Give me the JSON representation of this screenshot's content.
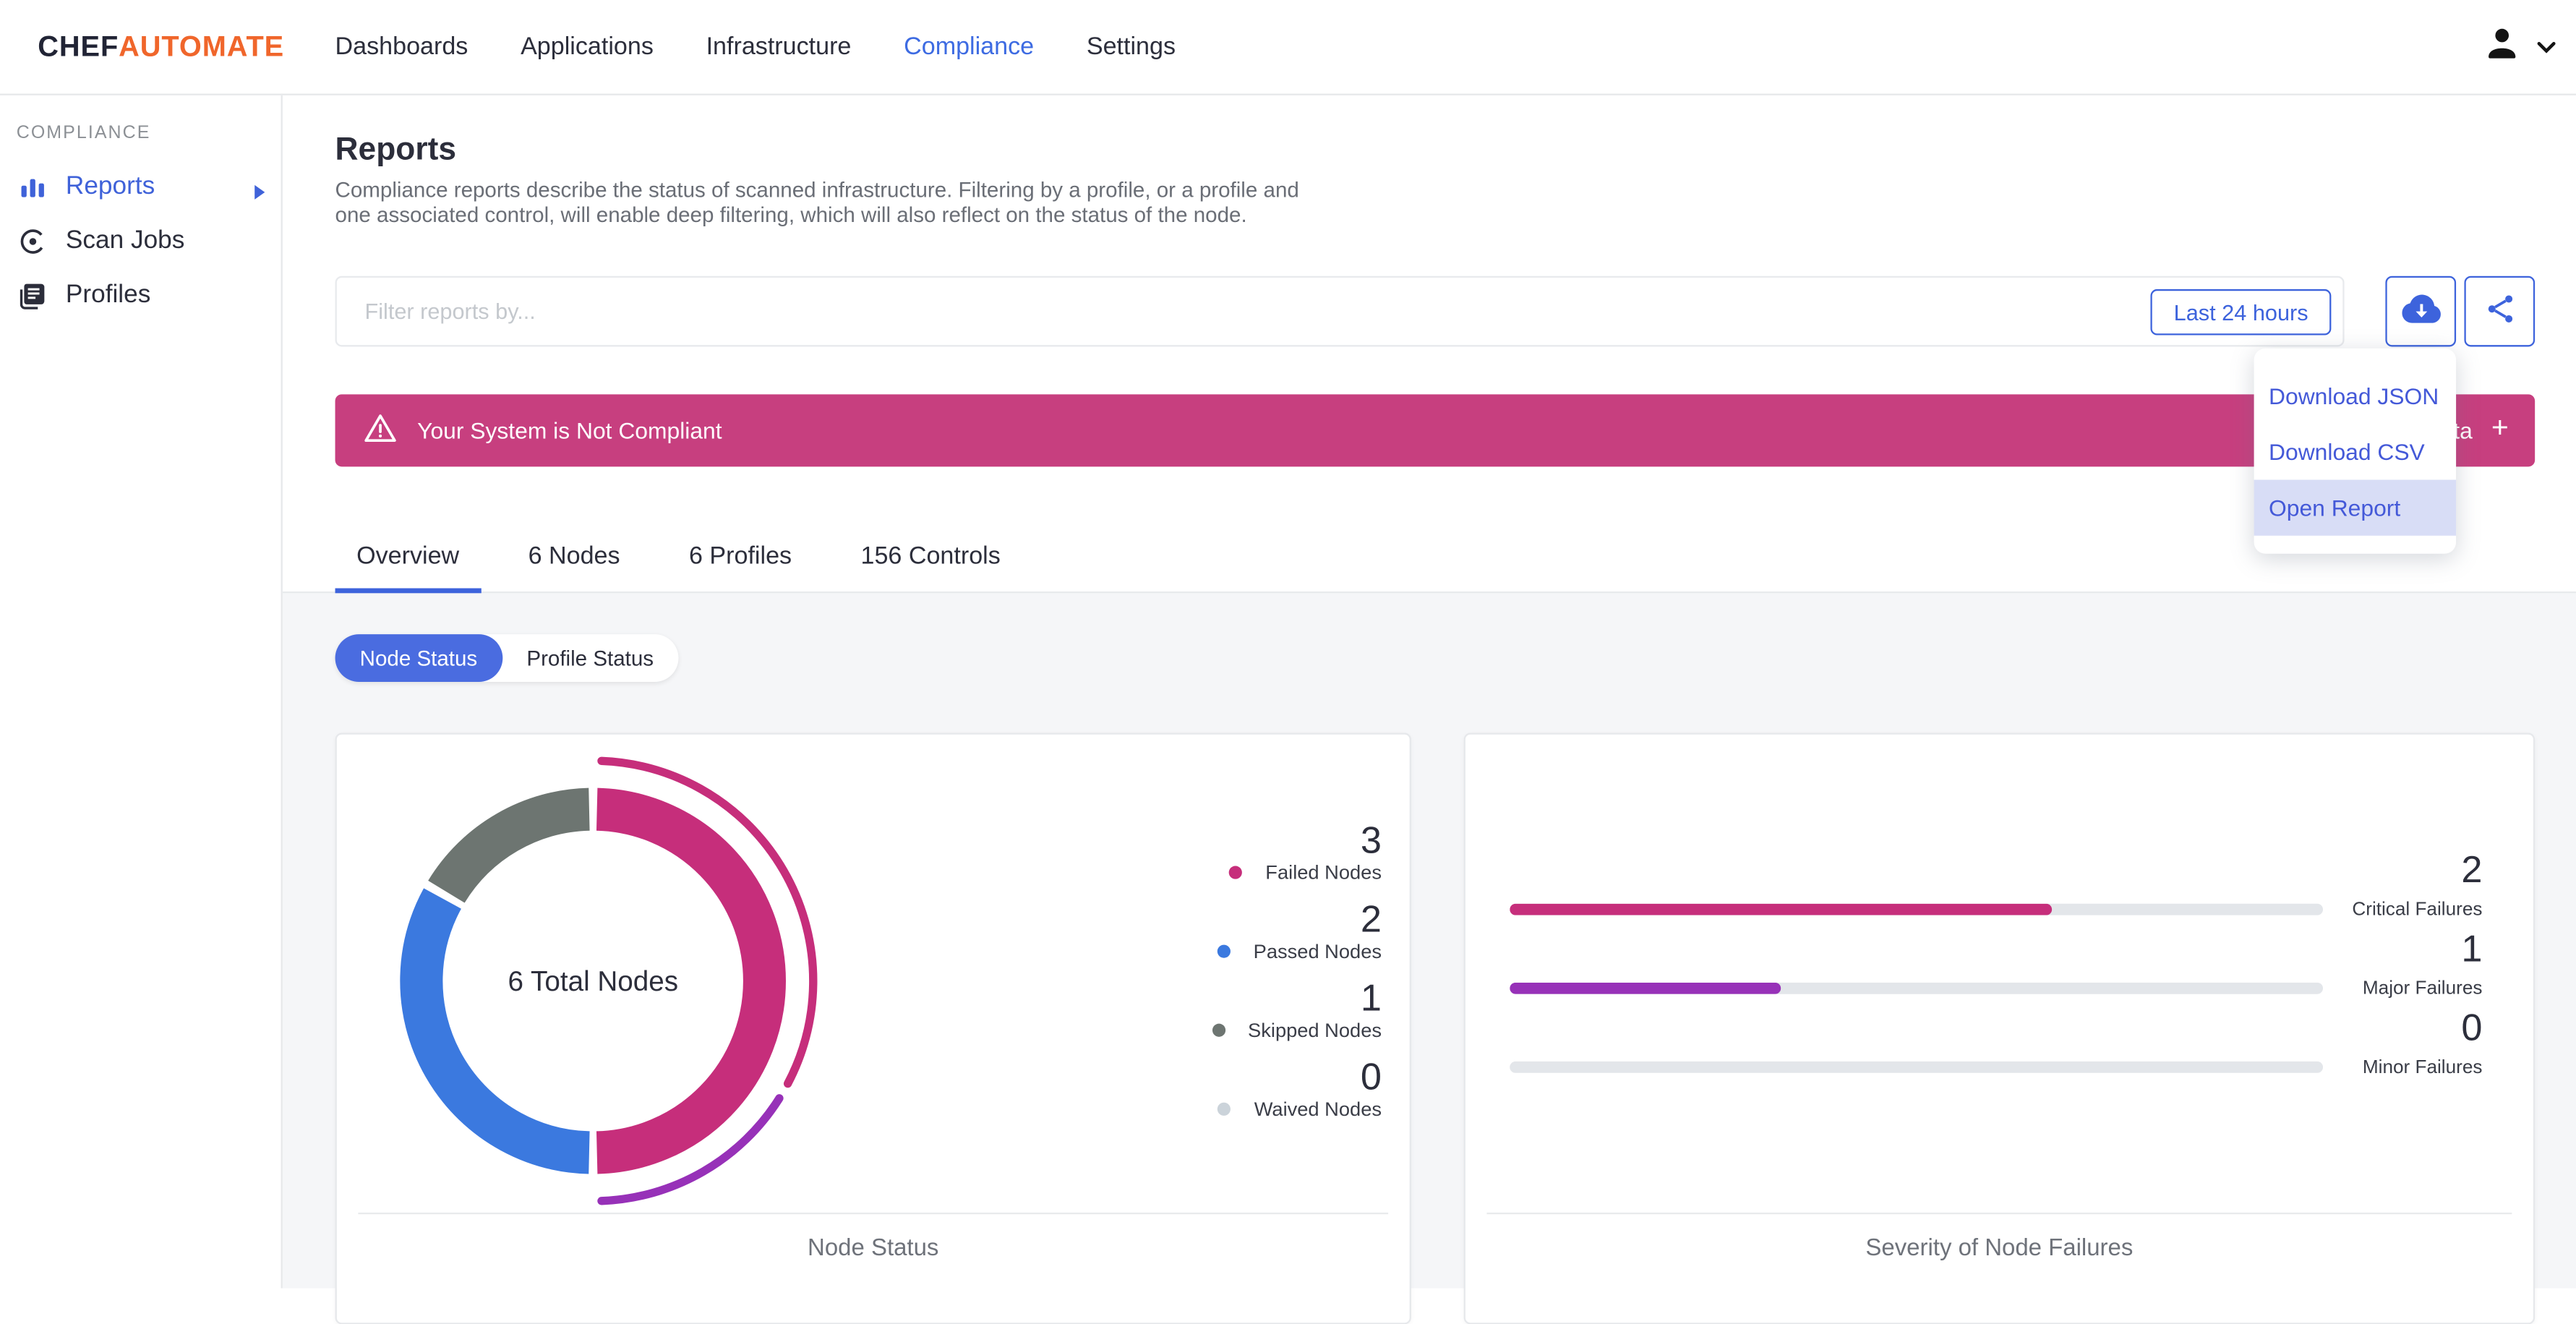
{
  "header": {
    "logo": {
      "bold": "CHEF",
      "light": "AUTOMATE"
    },
    "nav": [
      {
        "label": "Dashboards",
        "active": false
      },
      {
        "label": "Applications",
        "active": false
      },
      {
        "label": "Infrastructure",
        "active": false
      },
      {
        "label": "Compliance",
        "active": true
      },
      {
        "label": "Settings",
        "active": false
      }
    ]
  },
  "sidebar": {
    "section_label": "COMPLIANCE",
    "items": [
      {
        "label": "Reports",
        "icon": "bar-chart-icon",
        "active": true,
        "has_submenu": true
      },
      {
        "label": "Scan Jobs",
        "icon": "scan-icon",
        "active": false,
        "has_submenu": false
      },
      {
        "label": "Profiles",
        "icon": "profiles-icon",
        "active": false,
        "has_submenu": false
      }
    ]
  },
  "page": {
    "title": "Reports",
    "description_line1": "Compliance reports describe the status of scanned infrastructure. Filtering by a profile, or a profile and",
    "description_line2": "one associated control, will enable deep filtering, which will also reflect on the status of the node."
  },
  "filter": {
    "placeholder": "Filter reports by...",
    "time_range_label": "Last 24 hours"
  },
  "banner": {
    "text": "Your System is Not Compliant",
    "right_fragment": "ta",
    "plus_label": "+"
  },
  "download_menu": {
    "items": [
      {
        "label": "Download JSON",
        "highlighted": false
      },
      {
        "label": "Download CSV",
        "highlighted": false
      },
      {
        "label": "Open Report",
        "highlighted": true
      }
    ]
  },
  "tabs": [
    {
      "label": "Overview",
      "active": true
    },
    {
      "label": "6 Nodes",
      "active": false
    },
    {
      "label": "6 Profiles",
      "active": false
    },
    {
      "label": "156 Controls",
      "active": false
    }
  ],
  "status_toggle": [
    {
      "label": "Node Status",
      "active": true
    },
    {
      "label": "Profile Status",
      "active": false
    }
  ],
  "chart_data": [
    {
      "type": "pie",
      "title": "Node Status",
      "center_label": "6 Total Nodes",
      "total": 6,
      "slices": [
        {
          "label": "Failed Nodes",
          "value": 3,
          "color": "#C62E7B"
        },
        {
          "label": "Passed Nodes",
          "value": 2,
          "color": "#3B79DF"
        },
        {
          "label": "Skipped Nodes",
          "value": 1,
          "color": "#6D7571"
        },
        {
          "label": "Waived Nodes",
          "value": 0,
          "color": "#CBD3DA"
        }
      ],
      "outer_arcs": [
        {
          "label": "Critical",
          "value": 2,
          "color": "#C62E7B"
        },
        {
          "label": "Major",
          "value": 1,
          "color": "#9731B8"
        }
      ]
    },
    {
      "type": "bar",
      "title": "Severity of Node Failures",
      "categories": [
        "Critical Failures",
        "Major Failures",
        "Minor Failures"
      ],
      "values": [
        2,
        1,
        0
      ],
      "max": 3,
      "colors": [
        "#C62E7B",
        "#9731B8",
        "#E3E6EA"
      ]
    }
  ],
  "colors": {
    "accent_blue": "#3D63DC",
    "banner_pink": "#C73F7F",
    "chart_pink": "#C62E7B",
    "chart_blue": "#3B79DF",
    "chart_purple": "#9731B8",
    "chart_gray": "#6D7571",
    "waived_gray": "#CBD3DA",
    "track_gray": "#E3E6EA",
    "logo_orange": "#F0662B",
    "menu_highlight": "#D8DDF6"
  }
}
